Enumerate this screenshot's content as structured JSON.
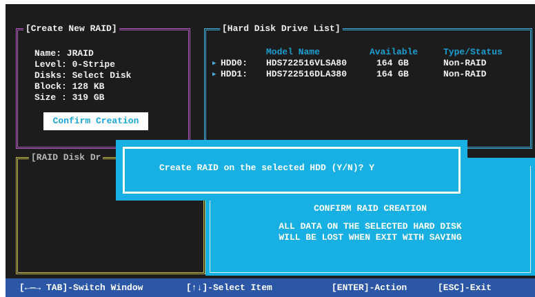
{
  "create_panel": {
    "title": "[Create New RAID]",
    "name_line": "Name: JRAID",
    "level_line": "Level: 0-Stripe",
    "disks_line": "Disks: Select Disk",
    "block_line": "Block: 128 KB",
    "size_line": "Size : 319 GB",
    "confirm_button": "Confirm Creation"
  },
  "raid_disk_panel": {
    "title": "[RAID Disk Dr"
  },
  "hdd_panel": {
    "title": "[Hard Disk Drive List]",
    "columns": [
      "Model Name",
      "Available",
      "Type/Status"
    ],
    "rows": [
      {
        "id": "HDD0:",
        "model": "HDS722516VLSA80",
        "available": "164 GB",
        "status": "Non-RAID"
      },
      {
        "id": "HDD1:",
        "model": "HDS722516DLA380",
        "available": "164 GB",
        "status": "Non-RAID"
      }
    ]
  },
  "dialog": {
    "prompt": "Create RAID on the selected HDD (Y/N)? Y"
  },
  "confirm_area": {
    "heading": "CONFIRM RAID CREATION",
    "warning_line1": "ALL DATA ON THE SELECTED HARD DISK",
    "warning_line2": "WILL BE LOST WHEN EXIT WITH SAVING"
  },
  "status_bar": {
    "switch_window": "[←—→ TAB]-Switch Window",
    "select_item": "[↑↓]-Select Item",
    "action": "[ENTER]-Action",
    "exit": "[ESC]-Exit"
  },
  "colors": {
    "background": "#1c1c1c",
    "accent_cyan": "#18b0e2",
    "status_bar": "#2c56a6",
    "create_panel_border": "#b85ac8",
    "raid_disk_panel_border": "#c8bd4a",
    "hdd_panel_border": "#3fb4df"
  }
}
